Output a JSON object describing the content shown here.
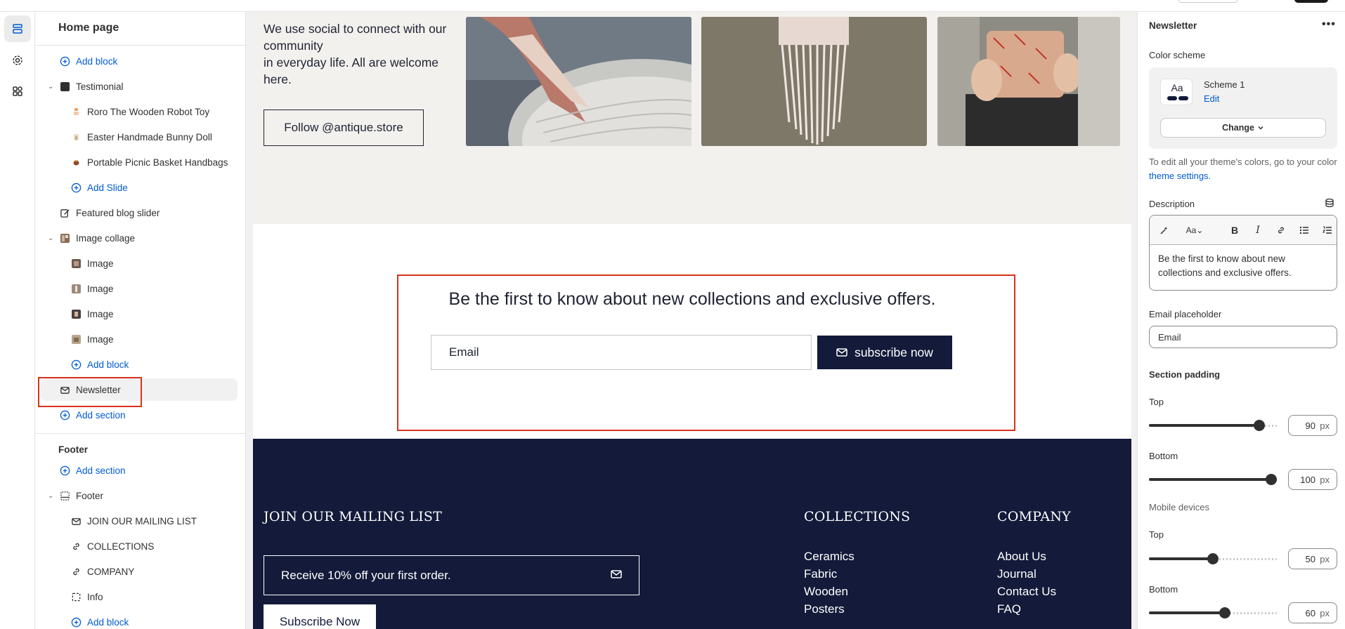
{
  "sidebar": {
    "title": "Home page",
    "rows": [
      {
        "kind": "add",
        "label": "Add block"
      },
      {
        "kind": "section",
        "label": "Testimonial"
      },
      {
        "kind": "block",
        "label": "Roro The Wooden Robot Toy"
      },
      {
        "kind": "block",
        "label": "Easter Handmade Bunny Doll"
      },
      {
        "kind": "block",
        "label": "Portable Picnic Basket Handbags"
      },
      {
        "kind": "add",
        "label": "Add Slide"
      },
      {
        "kind": "section",
        "label": "Featured blog slider"
      },
      {
        "kind": "section",
        "label": "Image collage"
      },
      {
        "kind": "block",
        "label": "Image"
      },
      {
        "kind": "block",
        "label": "Image"
      },
      {
        "kind": "block",
        "label": "Image"
      },
      {
        "kind": "block",
        "label": "Image"
      },
      {
        "kind": "add",
        "label": "Add block"
      },
      {
        "kind": "section",
        "label": "Newsletter"
      },
      {
        "kind": "add",
        "label": "Add section"
      }
    ],
    "footer_heading": "Footer",
    "footer_rows": [
      {
        "kind": "add",
        "label": "Add section"
      },
      {
        "kind": "section",
        "label": "Footer"
      },
      {
        "kind": "block",
        "label": "JOIN OUR MAILING LIST"
      },
      {
        "kind": "block",
        "label": "COLLECTIONS"
      },
      {
        "kind": "block",
        "label": "COMPANY"
      },
      {
        "kind": "block",
        "label": "Info"
      },
      {
        "kind": "add",
        "label": "Add block"
      }
    ]
  },
  "preview": {
    "social_text_1": "We use social to connect with our community",
    "social_text_2": "in everyday life. All are welcome here.",
    "follow_button": "Follow @antique.store",
    "newsletter_heading": "Be the first to know about new collections and exclusive offers.",
    "email_placeholder": "Email",
    "subscribe_button": "subscribe now",
    "footer": {
      "mailing_heading": "JOIN OUR MAILING LIST",
      "mailing_input": "Receive 10% off your first order.",
      "subscribe_button": "Subscribe Now",
      "collections_heading": "COLLECTIONS",
      "collections_links": [
        "Ceramics",
        "Fabric",
        "Wooden",
        "Posters"
      ],
      "company_heading": "COMPANY",
      "company_links": [
        "About Us",
        "Journal",
        "Contact Us",
        "FAQ"
      ]
    }
  },
  "settings": {
    "title": "Newsletter",
    "more_label": "•••",
    "color_scheme_label": "Color scheme",
    "scheme_swatch": "Aa",
    "scheme_name": "Scheme 1",
    "scheme_edit": "Edit",
    "change_button": "Change",
    "help_text": "To edit all your theme's colors, go to your color",
    "help_link": "theme settings.",
    "description_label": "Description",
    "description_text": "Be the first to know about new collections and exclusive offers.",
    "email_placeholder_label": "Email placeholder",
    "email_placeholder_value": "Email",
    "section_padding_label": "Section padding",
    "top_label": "Top",
    "top_value": "90",
    "top_max": 100,
    "bottom_label": "Bottom",
    "bottom_value": "100",
    "bottom_max": 100,
    "mobile_label": "Mobile devices",
    "mobile_top_label": "Top",
    "mobile_top_value": "50",
    "mobile_bottom_label": "Bottom",
    "mobile_bottom_value": "60",
    "unit": "px"
  },
  "colors": {
    "accent_link": "#005bd3",
    "navy": "#131a3a",
    "highlight": "#d8321c"
  }
}
